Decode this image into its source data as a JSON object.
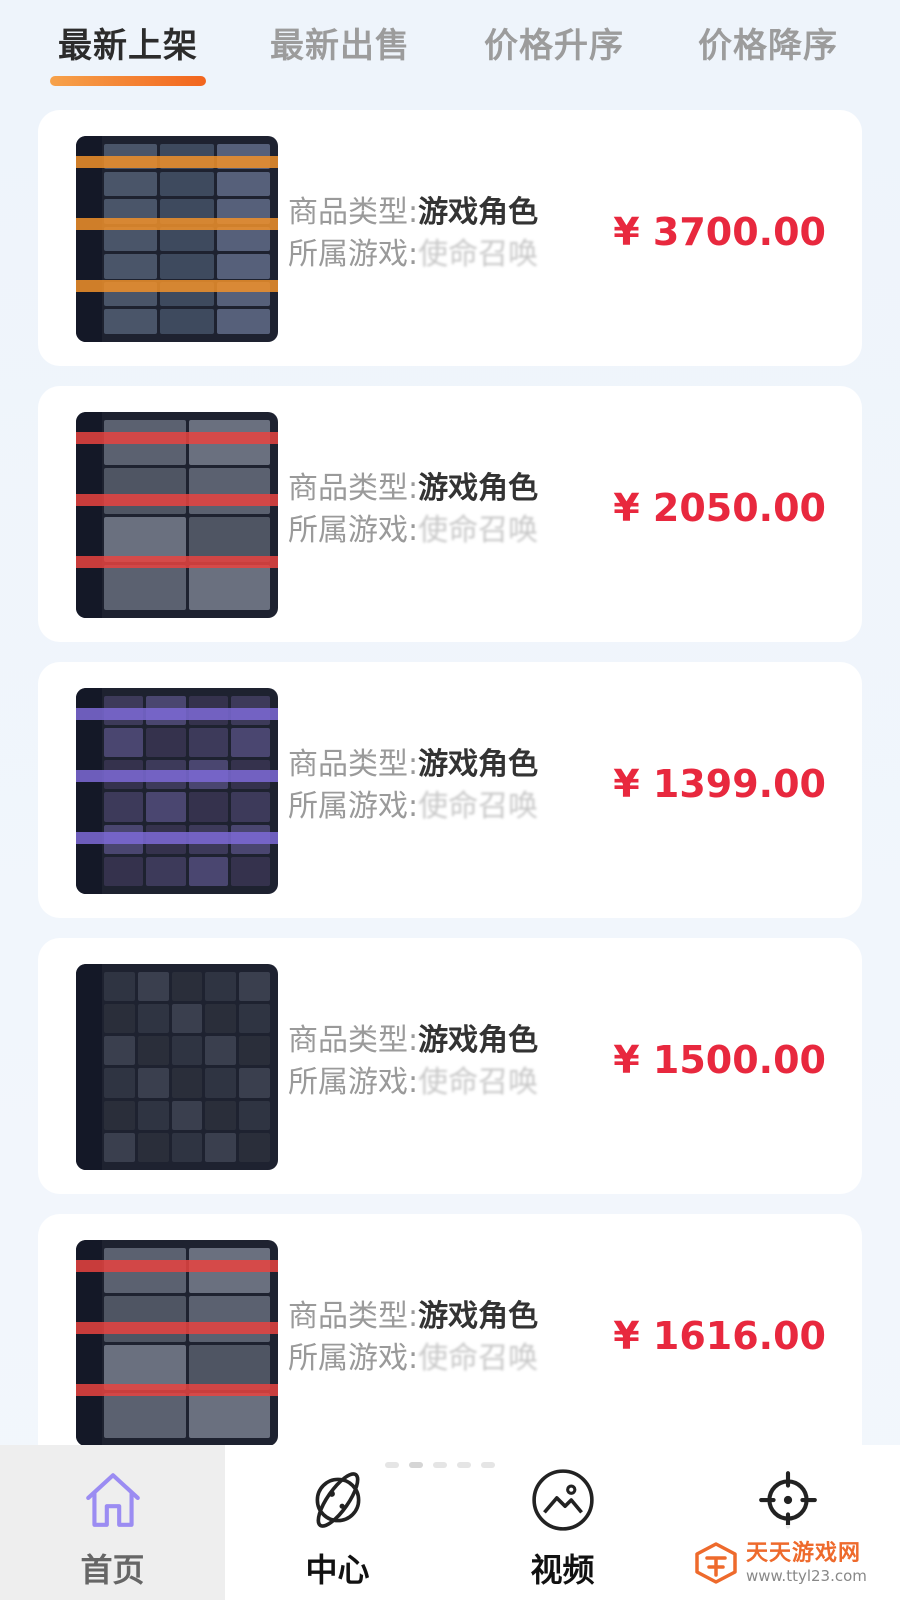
{
  "tabs": [
    {
      "label": "最新上架",
      "active": true
    },
    {
      "label": "最新出售",
      "active": false
    },
    {
      "label": "价格升序",
      "active": false
    },
    {
      "label": "价格降序",
      "active": false
    }
  ],
  "accent_colors": {
    "tab_underline": "#f2651e",
    "price": "#e8283e"
  },
  "listings": [
    {
      "type_label": "商品类型:",
      "type_value": "游戏角色",
      "game_label": "所属游戏:",
      "game_value": "使命召唤",
      "price": "¥ 3700.00"
    },
    {
      "type_label": "商品类型:",
      "type_value": "游戏角色",
      "game_label": "所属游戏:",
      "game_value": "使命召唤",
      "price": "¥ 2050.00"
    },
    {
      "type_label": "商品类型:",
      "type_value": "游戏角色",
      "game_label": "所属游戏:",
      "game_value": "使命召唤",
      "price": "¥ 1399.00"
    },
    {
      "type_label": "商品类型:",
      "type_value": "游戏角色",
      "game_label": "所属游戏:",
      "game_value": "使命召唤",
      "price": "¥ 1500.00"
    },
    {
      "type_label": "商品类型:",
      "type_value": "游戏角色",
      "game_label": "所属游戏:",
      "game_value": "使命召唤",
      "price": "¥ 1616.00"
    }
  ],
  "bottom_nav": [
    {
      "label": "首页",
      "icon": "home-icon",
      "active": true
    },
    {
      "label": "中心",
      "icon": "planet-icon",
      "active": false
    },
    {
      "label": "视频",
      "icon": "image-icon",
      "active": false
    },
    {
      "label": "",
      "icon": "crosshair-icon",
      "active": false
    }
  ],
  "watermark": {
    "name": "天天游戏网",
    "url": "www.ttyl23.com"
  }
}
